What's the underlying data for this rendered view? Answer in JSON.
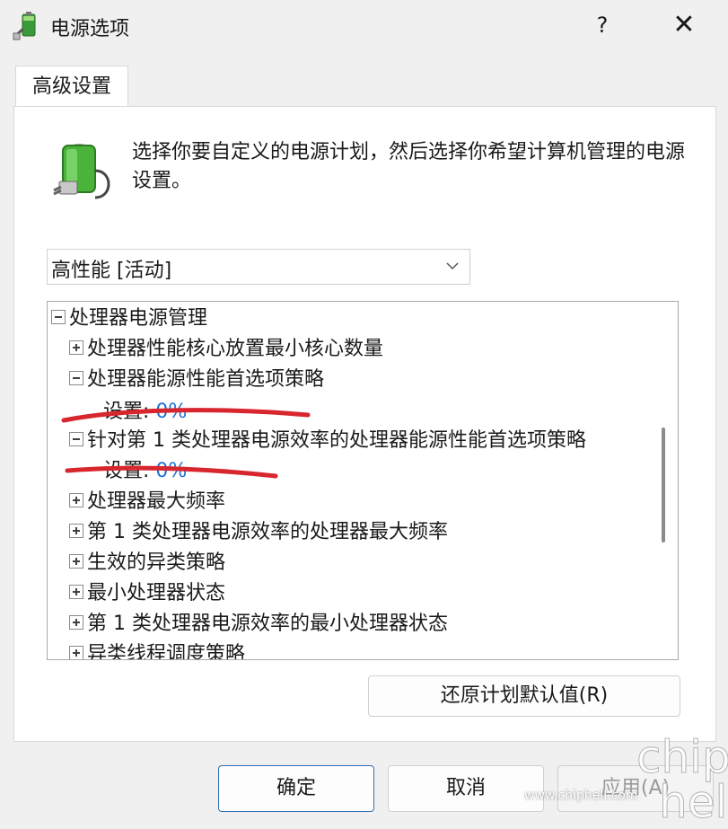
{
  "window": {
    "title": "电源选项",
    "help_label": "?",
    "close_label": "✕"
  },
  "tabs": [
    {
      "label": "高级设置",
      "selected": true
    }
  ],
  "description": "选择你要自定义的电源计划，然后选择你希望计算机管理的电源设置。",
  "plan_select": {
    "value": "高性能 [活动]"
  },
  "tree": {
    "items": [
      {
        "label": "处理器电源管理",
        "toggle": "minus"
      },
      {
        "label": "处理器性能核心放置最小核心数量",
        "toggle": "plus"
      },
      {
        "label": "处理器能源性能首选项策略",
        "toggle": "minus"
      },
      {
        "label": "设置:",
        "value": "0%"
      },
      {
        "label": "针对第 1 类处理器电源效率的处理器能源性能首选项策略",
        "toggle": "minus"
      },
      {
        "label": "设置:",
        "value": "0%"
      },
      {
        "label": "处理器最大频率",
        "toggle": "plus"
      },
      {
        "label": "第 1 类处理器电源效率的处理器最大频率",
        "toggle": "plus"
      },
      {
        "label": "生效的异类策略",
        "toggle": "plus"
      },
      {
        "label": "最小处理器状态",
        "toggle": "plus"
      },
      {
        "label": "第 1 类处理器电源效率的最小处理器状态",
        "toggle": "plus"
      },
      {
        "label": "异类线程调度策略",
        "toggle": "plus"
      }
    ]
  },
  "buttons": {
    "restore": "还原计划默认值(R)",
    "ok": "确定",
    "cancel": "取消",
    "apply": "应用(A)"
  },
  "watermark": {
    "logo": "chip hell",
    "url": "www.chiphell.com"
  },
  "colors": {
    "setting_value": "#1f6fd0",
    "annotation": "#d8262e"
  }
}
